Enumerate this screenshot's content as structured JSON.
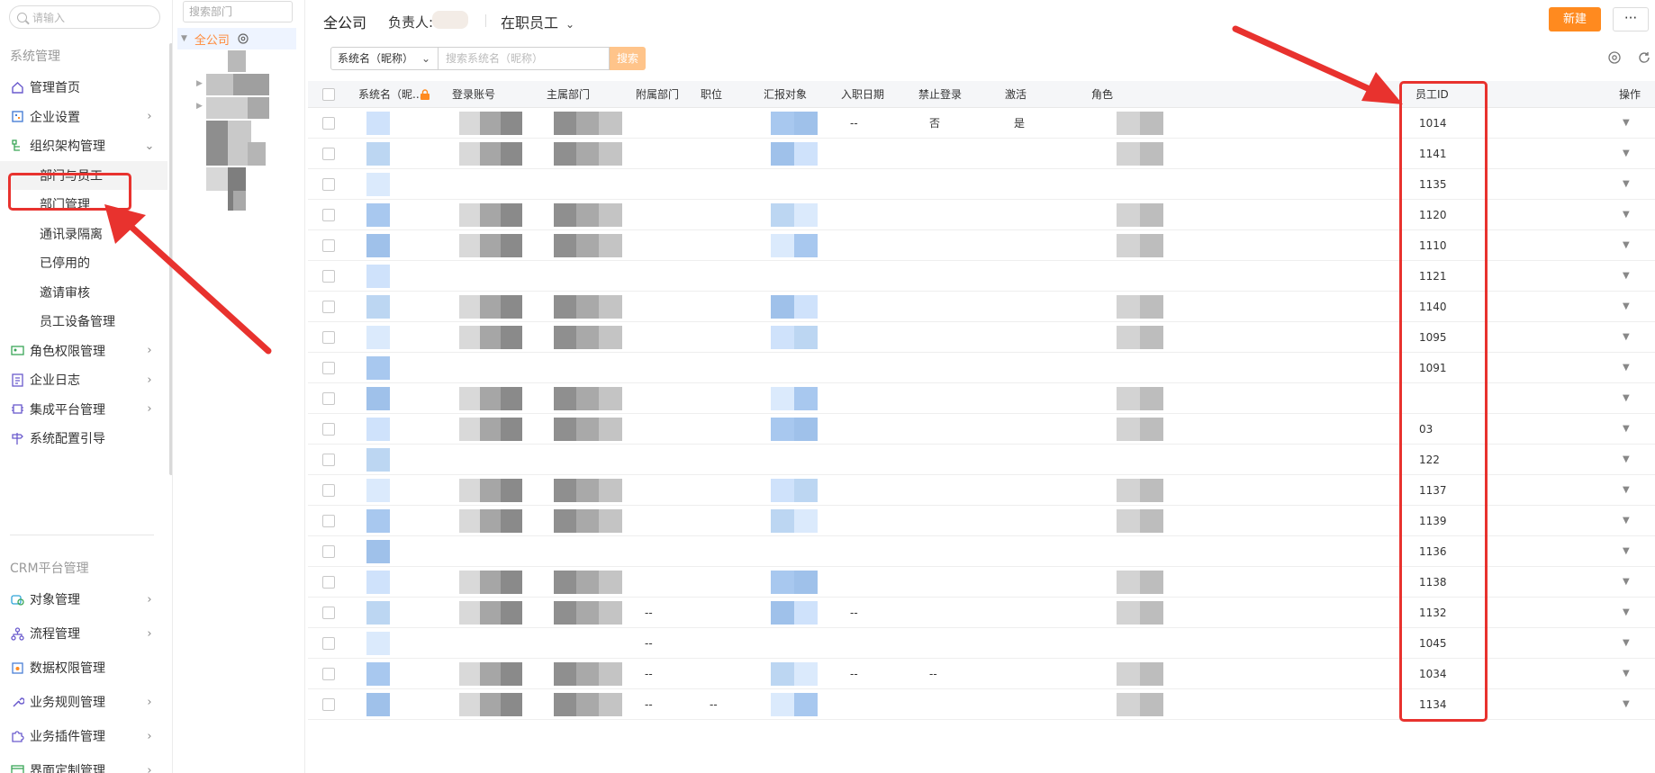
{
  "sidebar": {
    "search_placeholder": "请输入",
    "group_system": "系统管理",
    "group_crm": "CRM平台管理",
    "items": [
      {
        "label": "管理首页",
        "icon": "home-icon",
        "chev": ""
      },
      {
        "label": "企业设置",
        "icon": "building-icon",
        "chev": "›"
      },
      {
        "label": "组织架构管理",
        "icon": "org-tree-icon",
        "chev": "⌄"
      },
      {
        "label": "部门与员工",
        "icon": "",
        "chev": ""
      },
      {
        "label": "部门管理",
        "icon": "",
        "chev": ""
      },
      {
        "label": "通讯录隔离",
        "icon": "",
        "chev": ""
      },
      {
        "label": "已停用的",
        "icon": "",
        "chev": ""
      },
      {
        "label": "邀请审核",
        "icon": "",
        "chev": ""
      },
      {
        "label": "员工设备管理",
        "icon": "",
        "chev": ""
      },
      {
        "label": "角色权限管理",
        "icon": "id-card-icon",
        "chev": "›"
      },
      {
        "label": "企业日志",
        "icon": "log-icon",
        "chev": "›"
      },
      {
        "label": "集成平台管理",
        "icon": "chip-icon",
        "chev": "›"
      },
      {
        "label": "系统配置引导",
        "icon": "signpost-icon",
        "chev": ""
      }
    ],
    "crm_items": [
      {
        "label": "对象管理",
        "icon": "object-icon",
        "chev": "›"
      },
      {
        "label": "流程管理",
        "icon": "flow-icon",
        "chev": "›"
      },
      {
        "label": "数据权限管理",
        "icon": "data-permission-icon",
        "chev": ""
      },
      {
        "label": "业务规则管理",
        "icon": "wrench-icon",
        "chev": "›"
      },
      {
        "label": "业务插件管理",
        "icon": "puzzle-icon",
        "chev": "›"
      },
      {
        "label": "界面定制管理",
        "icon": "layout-icon",
        "chev": "›"
      }
    ]
  },
  "tree": {
    "search_placeholder": "搜索部门",
    "root": "全公司"
  },
  "header": {
    "title": "全公司",
    "owner_label": "负责人:",
    "status": "在职员工",
    "new_button": "新建",
    "more_button": "···"
  },
  "filter": {
    "field": "系统名（昵称）",
    "placeholder": "搜索系统名（昵称）",
    "search_button": "搜索"
  },
  "table": {
    "columns": [
      "系统名（昵...",
      "登录账号",
      "主属部门",
      "附属部门",
      "职位",
      "汇报对象",
      "入职日期",
      "禁止登录",
      "激活",
      "角色",
      "员工ID",
      "操作"
    ],
    "rows": [
      {
        "id": "1014",
        "date": "--",
        "banned": "否",
        "active": "是",
        "sub": "",
        "pos": "",
        "rep": ""
      },
      {
        "id": "1141",
        "date": "",
        "banned": "",
        "active": "",
        "sub": "",
        "pos": "",
        "rep": ""
      },
      {
        "id": "1135",
        "date": "",
        "banned": "",
        "active": "",
        "sub": "",
        "pos": "",
        "rep": ""
      },
      {
        "id": "1120",
        "date": "",
        "banned": "",
        "active": "",
        "sub": "",
        "pos": "",
        "rep": ""
      },
      {
        "id": "1110",
        "date": "",
        "banned": "",
        "active": "",
        "sub": "",
        "pos": "",
        "rep": ""
      },
      {
        "id": "1121",
        "date": "",
        "banned": "",
        "active": "",
        "sub": "",
        "pos": "",
        "rep": ""
      },
      {
        "id": "1140",
        "date": "",
        "banned": "",
        "active": "",
        "sub": "",
        "pos": "",
        "rep": ""
      },
      {
        "id": "1095",
        "date": "",
        "banned": "",
        "active": "",
        "sub": "",
        "pos": "",
        "rep": ""
      },
      {
        "id": "1091",
        "date": "",
        "banned": "",
        "active": "",
        "sub": "",
        "pos": "",
        "rep": ""
      },
      {
        "id": "",
        "date": "",
        "banned": "",
        "active": "",
        "sub": "",
        "pos": "",
        "rep": ""
      },
      {
        "id": "03",
        "date": "",
        "banned": "",
        "active": "",
        "sub": "",
        "pos": "",
        "rep": ""
      },
      {
        "id": "122",
        "date": "",
        "banned": "",
        "active": "",
        "sub": "",
        "pos": "",
        "rep": ""
      },
      {
        "id": "1137",
        "date": "",
        "banned": "",
        "active": "",
        "sub": "",
        "pos": "",
        "rep": ""
      },
      {
        "id": "1139",
        "date": "",
        "banned": "",
        "active": "",
        "sub": "",
        "pos": "",
        "rep": ""
      },
      {
        "id": "1136",
        "date": "",
        "banned": "",
        "active": "",
        "sub": "",
        "pos": "",
        "rep": ""
      },
      {
        "id": "1138",
        "date": "",
        "banned": "",
        "active": "",
        "sub": "",
        "pos": "",
        "rep": ""
      },
      {
        "id": "1132",
        "date": "--",
        "banned": "",
        "active": "",
        "sub": "--",
        "pos": "",
        "rep": ""
      },
      {
        "id": "1045",
        "date": "",
        "banned": "",
        "active": "",
        "sub": "--",
        "pos": "",
        "rep": ""
      },
      {
        "id": "1034",
        "date": "--",
        "banned": "--",
        "active": "",
        "sub": "--",
        "pos": "",
        "rep": ""
      },
      {
        "id": "1134",
        "date": "",
        "banned": "",
        "active": "",
        "sub": "--",
        "pos": "--",
        "rep": ""
      }
    ]
  },
  "colors": {
    "accent": "#ff8a1f",
    "highlight": "#e8322e",
    "active_tree": "#ff8a3a"
  }
}
